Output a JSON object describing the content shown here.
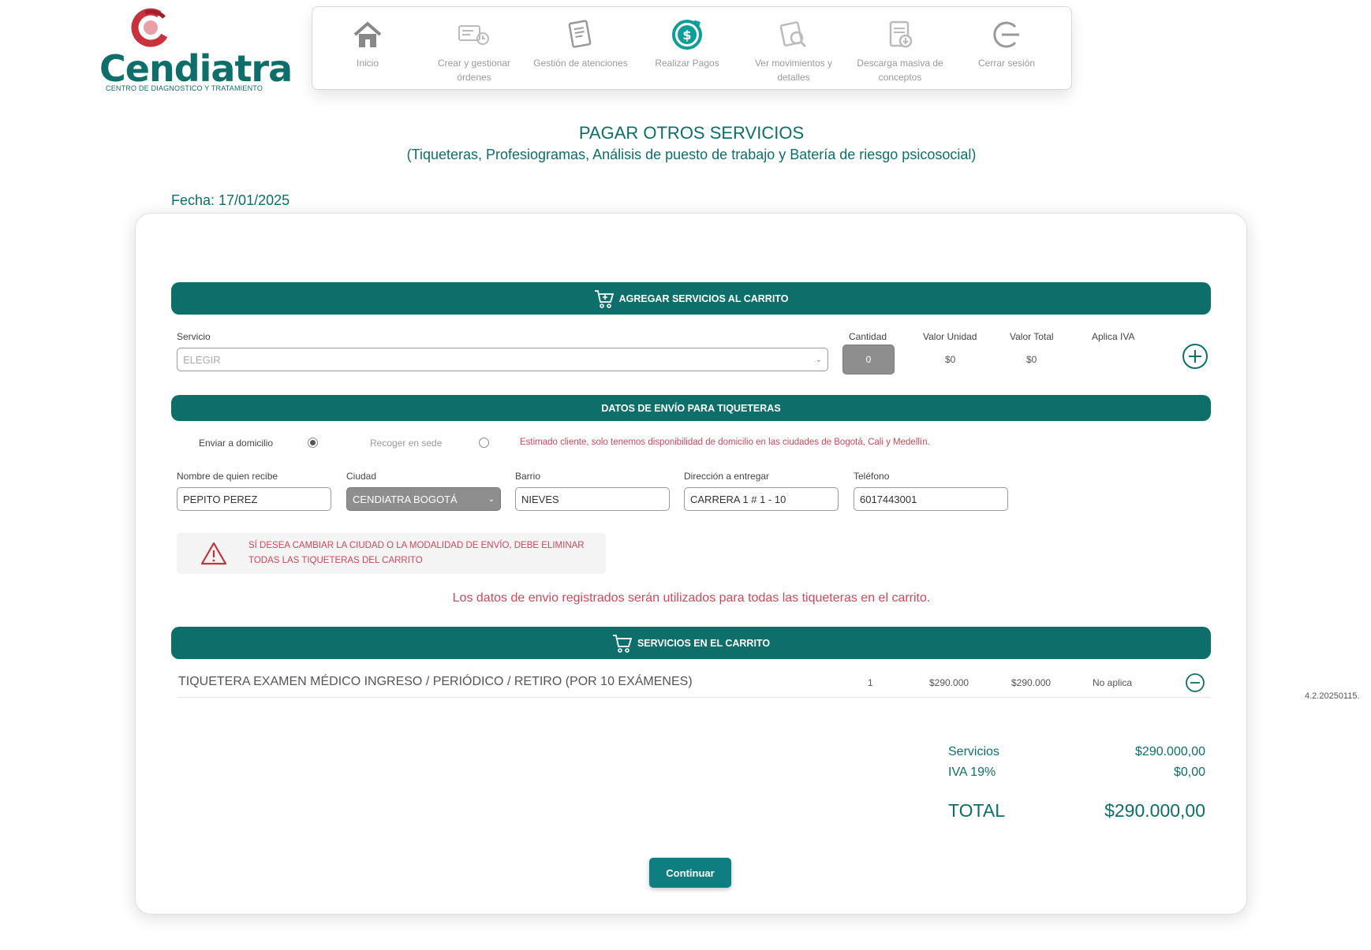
{
  "brand": {
    "name": "Cendiatra",
    "tagline": "CENTRO DE DIAGNOSTICO Y TRATAMIENTO"
  },
  "nav": {
    "items": [
      {
        "label": "Inicio",
        "icon": "home-icon"
      },
      {
        "label": "Crear y gestionar órdenes",
        "icon": "orders-icon"
      },
      {
        "label": "Gestión de atenciones",
        "icon": "document-icon"
      },
      {
        "label": "Realizar Pagos",
        "icon": "payment-icon",
        "active": true
      },
      {
        "label": "Ver movimientos y detalles",
        "icon": "movements-icon"
      },
      {
        "label": "Descarga masiva de conceptos",
        "icon": "download-icon"
      },
      {
        "label": "Cerrar sesión",
        "icon": "logout-icon"
      }
    ]
  },
  "page": {
    "title": "PAGAR OTROS SERVICIOS",
    "subtitle": "(Tiqueteras, Profesiogramas, Análisis de puesto de trabajo y Batería de riesgo psicosocial)",
    "date": "Fecha: 17/01/2025"
  },
  "add_services": {
    "header": "AGREGAR SERVICIOS AL CARRITO",
    "service_label": "Servicio",
    "service_placeholder": "ELEGIR",
    "quantity_label": "Cantidad",
    "quantity_value": "0",
    "unit_value_label": "Valor Unidad",
    "unit_value": "$0",
    "total_value_label": "Valor Total",
    "total_value": "$0",
    "iva_label": "Aplica IVA"
  },
  "shipping": {
    "header": "DATOS DE ENVÍO PARA TIQUETERAS",
    "option_home": "Enviar a domicilio",
    "option_pickup": "Recoger en sede",
    "notice": "Estimado cliente, solo tenemos disponibilidad de domicilio en las ciudades de Bogotá, Cali y Medellín.",
    "recipient_label": "Nombre de quien recibe",
    "recipient_value": "PEPITO PEREZ",
    "city_label": "Ciudad",
    "city_value": "CENDIATRA BOGOTÁ",
    "district_label": "Barrio",
    "district_value": "NIEVES",
    "address_label": "Dirección a entregar",
    "address_value": "CARRERA 1 # 1 - 10",
    "phone_label": "Teléfono",
    "phone_value": "6017443001",
    "warning_line1": "SÍ DESEA CAMBIAR LA CIUDAD O LA MODALIDAD DE ENVÍO, DEBE ELIMINAR",
    "warning_line2": "TODAS LAS TIQUETERAS DEL CARRITO",
    "info": "Los datos de envio registrados serán utilizados para todas las tiqueteras en el carrito."
  },
  "cart": {
    "header": "SERVICIOS EN EL CARRITO",
    "items": [
      {
        "name": "TIQUETERA EXAMEN MÉDICO INGRESO / PERIÓDICO / RETIRO (POR 10 EXÁMENES)",
        "quantity": "1",
        "unit": "$290.000",
        "total": "$290.000",
        "iva": "No aplica"
      }
    ]
  },
  "totals": {
    "services_label": "Servicios",
    "services_value": "$290.000,00",
    "iva_label": "IVA 19%",
    "iva_value": "$0,00",
    "total_label": "TOTAL",
    "total_value": "$290.000,00"
  },
  "continue_label": "Continuar",
  "version": "4.2.20250115.",
  "colors": {
    "primary": "#0e6e6a",
    "warning": "#d0485a",
    "brand_red": "#c8323c"
  }
}
